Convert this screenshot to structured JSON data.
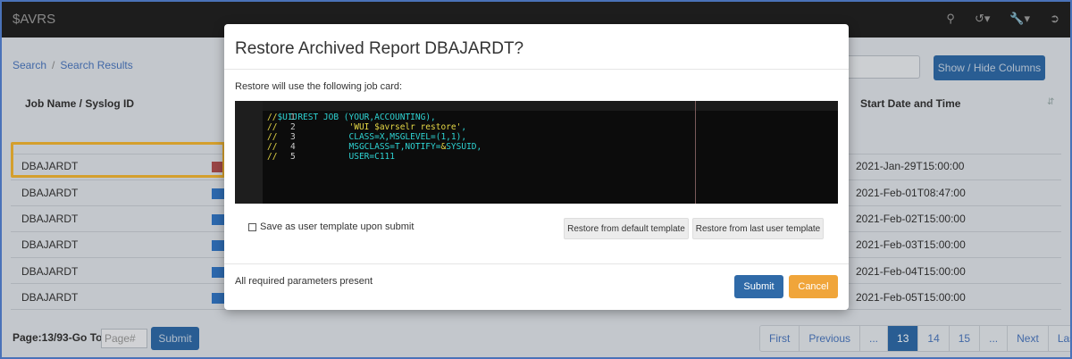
{
  "app": {
    "title": "$AVRS"
  },
  "nav_icons": [
    "search-icon",
    "history-icon",
    "wrench-icon",
    "logout-icon"
  ],
  "breadcrumb": [
    "Search",
    "Search Results"
  ],
  "toolbar": {
    "columns_button": "Show / Hide Columns"
  },
  "table": {
    "headers": {
      "job_name": "Job Name / Syslog ID",
      "start": "Start Date and Time"
    },
    "rows": [
      {
        "job": "DBAJARDT",
        "start": "2021-Jan-29T15:00:00"
      },
      {
        "job": "DBAJARDT",
        "start": "2021-Feb-01T08:47:00"
      },
      {
        "job": "DBAJARDT",
        "start": "2021-Feb-02T15:00:00"
      },
      {
        "job": "DBAJARDT",
        "start": "2021-Feb-03T15:00:00"
      },
      {
        "job": "DBAJARDT",
        "start": "2021-Feb-04T15:00:00"
      },
      {
        "job": "DBAJARDT",
        "start": "2021-Feb-05T15:00:00"
      }
    ]
  },
  "footer": {
    "page_label": "Page:13/93-Go To:",
    "page_placeholder": "Page#",
    "submit": "Submit",
    "pager": [
      "First",
      "Previous",
      "...",
      "13",
      "14",
      "15",
      "...",
      "Next",
      "Last"
    ],
    "active_page": "13"
  },
  "modal": {
    "title": "Restore Archived Report DBAJARDT?",
    "subtitle": "Restore will use the following job card:",
    "code_lines": [
      {
        "n": "1",
        "text": "//$UIJREST JOB (YOUR,ACCOUNTING),"
      },
      {
        "n": "2",
        "text": "//              'WUI $avrselr restore',"
      },
      {
        "n": "3",
        "text": "//              CLASS=X,MSGLEVEL=(1,1),"
      },
      {
        "n": "4",
        "text": "//              MSGCLASS=T,NOTIFY=&SYSUID,"
      },
      {
        "n": "5",
        "text": "//              USER=C111"
      }
    ],
    "save_template": "Save as user template upon submit",
    "restore_default": "Restore from default template",
    "restore_last": "Restore from last user template",
    "status": "All required parameters present",
    "submit": "Submit",
    "cancel": "Cancel"
  },
  "colors": {
    "primary": "#2f6aa8",
    "warning": "#f0a53a",
    "highlight": "#f2b534",
    "navbar": "#222222"
  }
}
